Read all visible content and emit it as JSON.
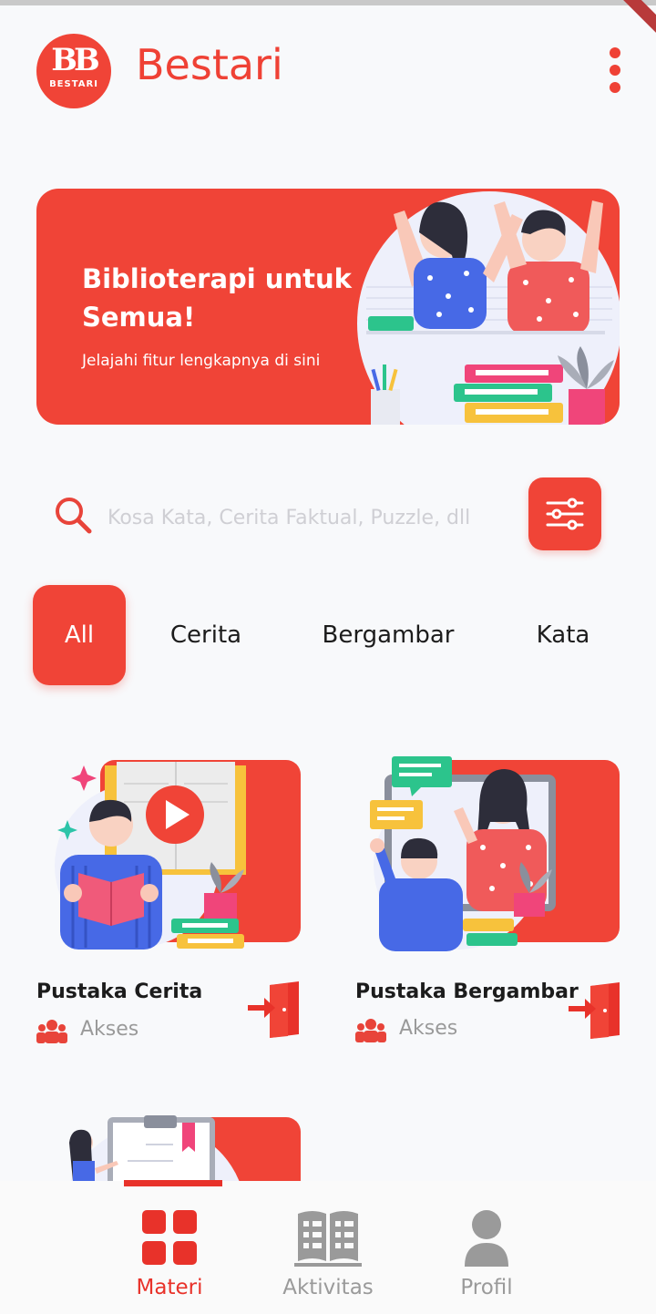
{
  "header": {
    "logo_mark": "BB",
    "logo_text": "BESTARI",
    "title": "Bestari"
  },
  "banner": {
    "title": "Biblioterapi untuk Semua!",
    "subtitle": "Jelajahi fitur lengkapnya di sini"
  },
  "search": {
    "placeholder": "Kosa Kata, Cerita Faktual, Puzzle, dll",
    "value": ""
  },
  "categories": [
    {
      "label": "All",
      "active": true
    },
    {
      "label": "Cerita",
      "active": false
    },
    {
      "label": "Bergambar",
      "active": false
    },
    {
      "label": "Kata",
      "active": false
    }
  ],
  "cards": [
    {
      "title": "Pustaka Cerita",
      "access": "Akses"
    },
    {
      "title": "Pustaka Bergambar",
      "access": "Akses"
    }
  ],
  "bottom_nav": [
    {
      "label": "Materi",
      "icon": "grid-icon",
      "active": true
    },
    {
      "label": "Aktivitas",
      "icon": "book-icon",
      "active": false
    },
    {
      "label": "Profil",
      "icon": "person-icon",
      "active": false
    }
  ],
  "colors": {
    "accent": "#f04437",
    "nav_active": "#e8322a",
    "nav_inactive": "#9a9a9a"
  }
}
